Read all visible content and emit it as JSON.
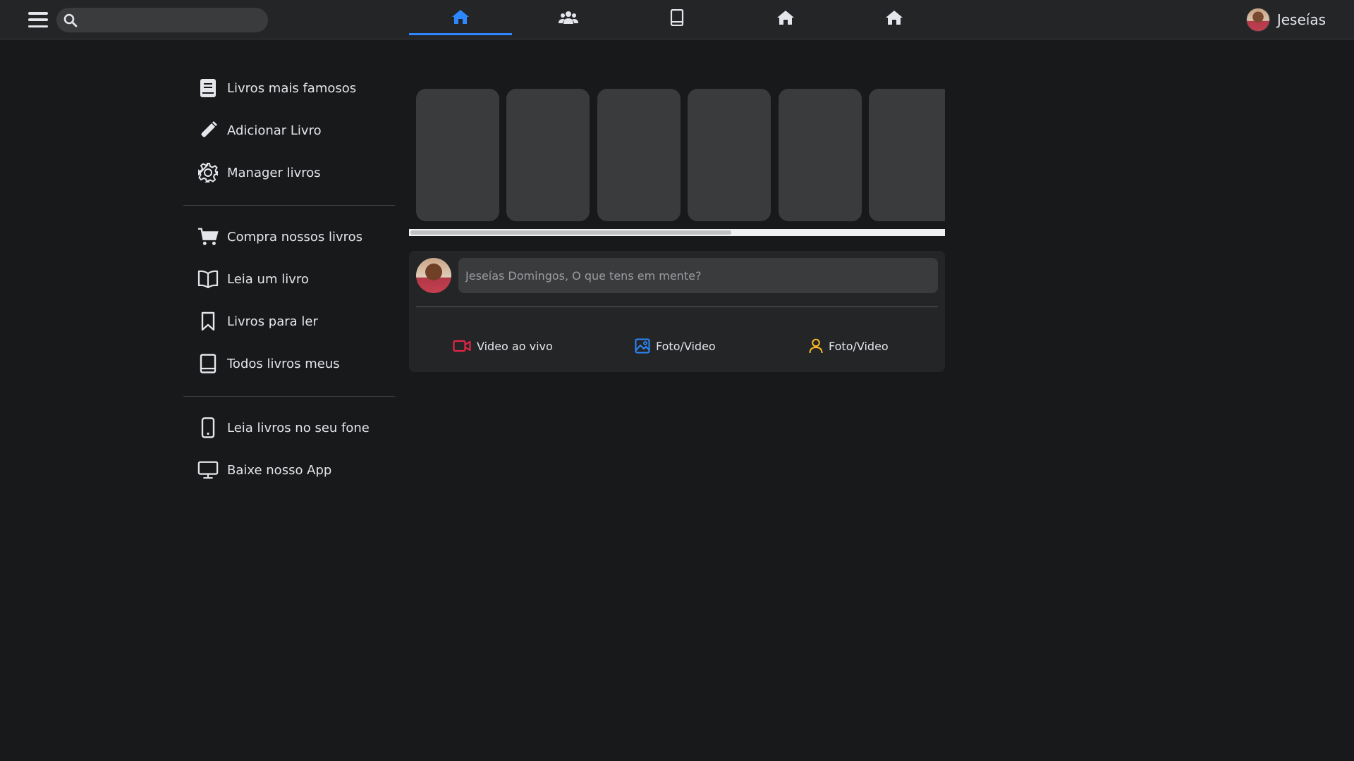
{
  "topbar": {
    "search": {
      "placeholder": "",
      "value": ""
    },
    "nav_tabs": [
      {
        "icon": "home-icon",
        "active": true
      },
      {
        "icon": "users-icon",
        "active": false
      },
      {
        "icon": "book-icon",
        "active": false
      },
      {
        "icon": "home-icon",
        "active": false
      },
      {
        "icon": "home-icon",
        "active": false
      }
    ],
    "user_name": "Jeseías"
  },
  "sidebar": {
    "groups": [
      [
        {
          "label": "Livros mais famosos",
          "icon": "book-icon"
        },
        {
          "label": "Adicionar Livro",
          "icon": "pencil-icon"
        },
        {
          "label": "Manager livros",
          "icon": "gear-icon"
        }
      ],
      [
        {
          "label": "Compra nossos livros",
          "icon": "cart-icon"
        },
        {
          "label": "Leia um livro",
          "icon": "open-book-icon"
        },
        {
          "label": "Livros para ler",
          "icon": "bookmark-icon"
        },
        {
          "label": "Todos livros meus",
          "icon": "book-outline-icon"
        }
      ],
      [
        {
          "label": "Leia livros no seu fone",
          "icon": "phone-icon"
        },
        {
          "label": "Baixe nosso App",
          "icon": "desktop-icon"
        }
      ]
    ]
  },
  "stories": {
    "count": 6,
    "scroll_fraction": 0.6
  },
  "create_post": {
    "placeholder": "Jeseías Domingos, O que tens em mente?",
    "actions": [
      {
        "label": "Video ao vivo",
        "icon": "video-camera-icon",
        "color": "#e42645"
      },
      {
        "label": "Foto/Video",
        "icon": "image-icon",
        "color": "#2d88ff"
      },
      {
        "label": "Foto/Video",
        "icon": "user-icon",
        "color": "#f7b928"
      }
    ]
  },
  "colors": {
    "background": "#18191a",
    "surface": "#242526",
    "accent": "#2d88ff"
  }
}
